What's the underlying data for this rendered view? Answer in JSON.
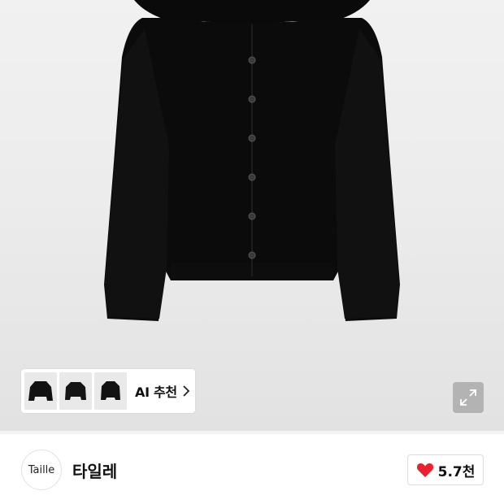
{
  "gallery": {
    "recommend_label": "AI 추천",
    "thumbnail_count": 3
  },
  "brand": {
    "logo_text": "Taille",
    "name": "타일레"
  },
  "likes": {
    "count": "5.7천"
  },
  "colors": {
    "heart": "#e8232f",
    "product": "#0b0b0b"
  },
  "icons": {
    "expand": "expand-icon",
    "chevron": "chevron-right-icon",
    "heart": "heart-icon"
  }
}
